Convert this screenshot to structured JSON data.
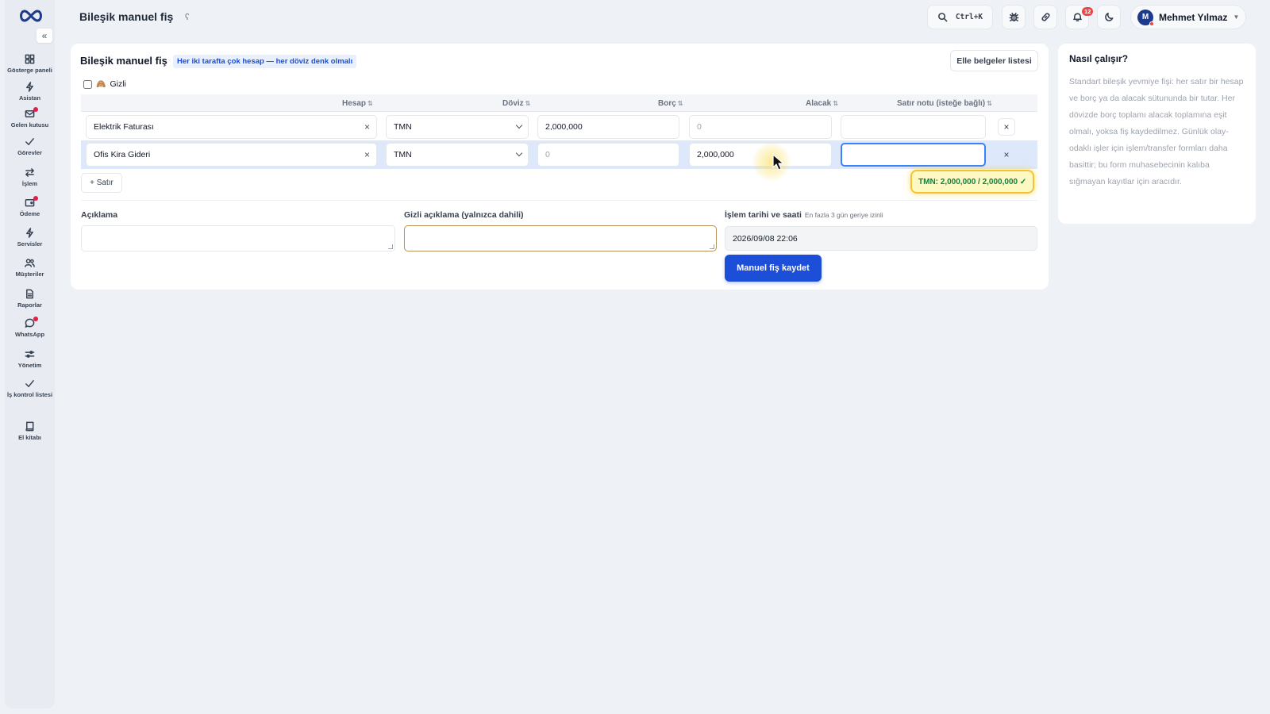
{
  "header": {
    "title": "Bileşik manuel fiş",
    "search_shortcut": "Ctrl+K",
    "notification_count": "12",
    "user_initial": "M",
    "user_name": "Mehmet Yılmaz"
  },
  "sidebar": {
    "items": [
      {
        "label": "Gösterge paneli",
        "icon": "grid-icon"
      },
      {
        "label": "Asistan",
        "icon": "bolt-icon"
      },
      {
        "label": "Gelen kutusu",
        "icon": "inbox-icon"
      },
      {
        "label": "Görevler",
        "icon": "check-icon"
      },
      {
        "label": "İşlem",
        "icon": "transfer-icon"
      },
      {
        "label": "Ödeme",
        "icon": "wallet-icon"
      },
      {
        "label": "Servisler",
        "icon": "bolt-icon"
      },
      {
        "label": "Müşteriler",
        "icon": "users-icon"
      },
      {
        "label": "Raporlar",
        "icon": "file-icon"
      },
      {
        "label": "WhatsApp",
        "icon": "chat-icon"
      },
      {
        "label": "Yönetim",
        "icon": "sliders-icon"
      },
      {
        "label": "İş kontrol listesi",
        "icon": "check-icon"
      },
      {
        "label": "El kitabı",
        "icon": "book-icon"
      }
    ]
  },
  "form": {
    "title": "Bileşik manuel fiş",
    "title_chip": "Her iki tarafta çok hesap — her döviz denk olmalı",
    "list_button": "Elle belgeler listesi",
    "hidden_label": "Gizli",
    "columns": {
      "account": "Hesap",
      "currency": "Döviz",
      "debit": "Borç",
      "credit": "Alacak",
      "note": "Satır notu (isteğe bağlı)"
    },
    "rows": [
      {
        "account": "Elektrik Faturası",
        "currency": "TMN",
        "debit": "2,000,000",
        "credit": "0",
        "note": ""
      },
      {
        "account": "Ofis Kira Gideri",
        "currency": "TMN",
        "debit": "0",
        "credit": "2,000,000",
        "note": ""
      }
    ],
    "add_row": "+ Satır",
    "balance": "TMN: 2,000,000 / 2,000,000 ✓",
    "description_label": "Açıklama",
    "hidden_description_label": "Gizli açıklama (yalnızca dahili)",
    "date_label": "İşlem tarihi ve saati",
    "date_hint": "En fazla 3 gün geriye izinli",
    "date_value": "2026/09/08 22:06",
    "save_button": "Manuel fiş kaydet"
  },
  "help": {
    "title": "Nasıl çalışır?",
    "text": "Standart bileşik yevmiye fişi: her satır bir hesap ve borç ya da alacak sütununda bir tutar. Her dövizde borç toplamı alacak toplamına eşit olmalı, yoksa fiş kaydedilmez. Günlük olay-odaklı işler için işlem/transfer formları daha basittir; bu form muhasebecinin kalıba sığmayan kayıtlar için aracıdır."
  }
}
